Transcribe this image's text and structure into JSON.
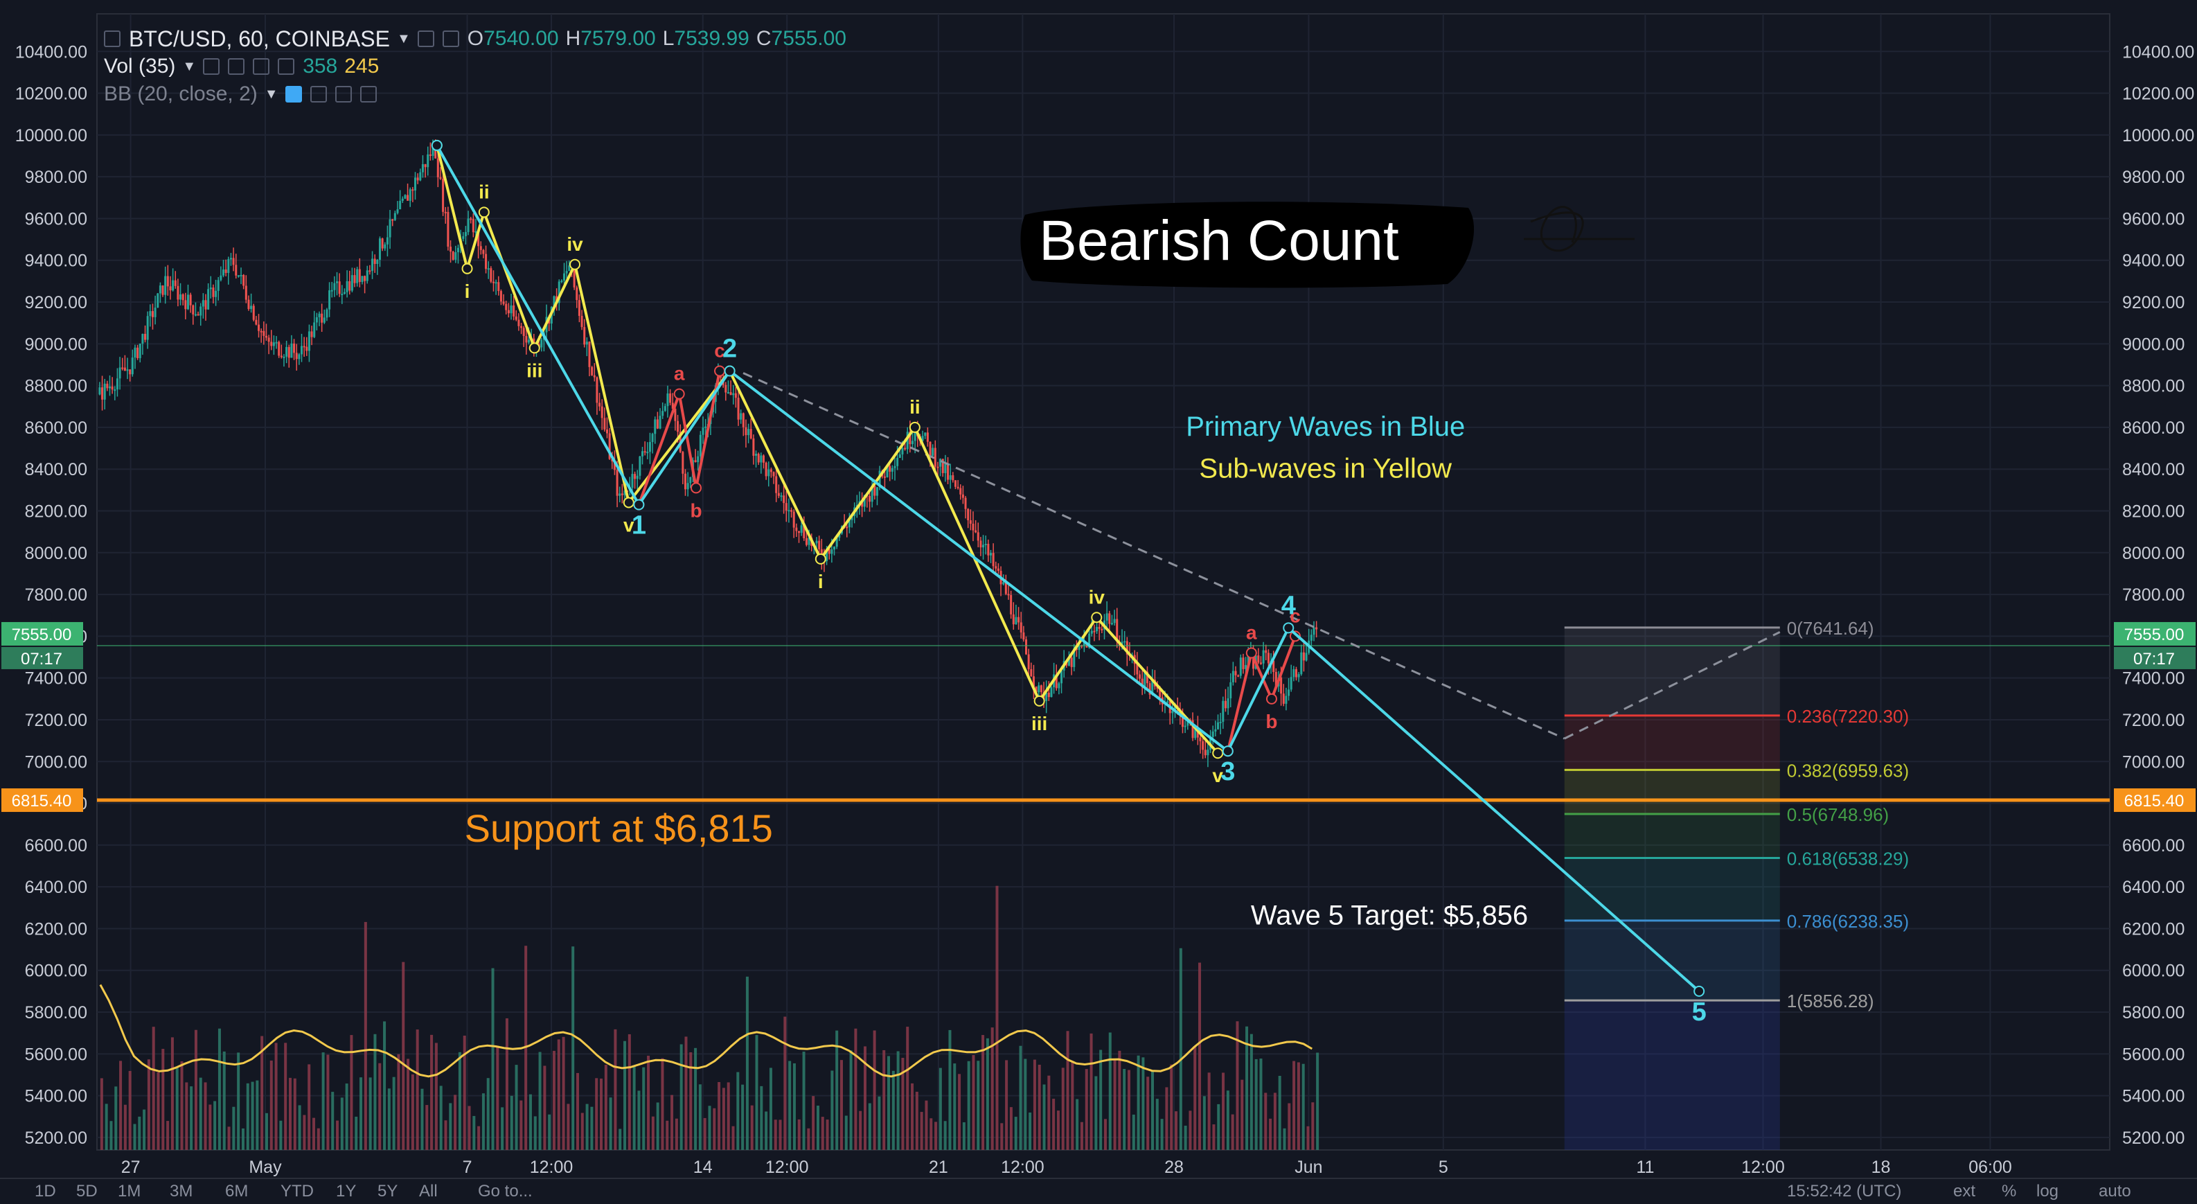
{
  "header": {
    "symbol": "BTC/USD, 60, COINBASE",
    "o_label": "O",
    "o_value": "7540.00",
    "h_label": "H",
    "h_value": "7579.00",
    "l_label": "L",
    "l_value": "7539.99",
    "c_label": "C",
    "c_value": "7555.00"
  },
  "indicators": {
    "vol_label": "Vol (35)",
    "vol_value_1": "358",
    "vol_value_2": "245",
    "bb_label": "BB (20, close, 2)"
  },
  "bottom_bar": {
    "intervals": [
      "1D",
      "5D",
      "1M",
      "3M",
      "6M",
      "YTD",
      "1Y",
      "5Y",
      "All"
    ],
    "goto": "Go to...",
    "time": "15:52:42 (UTC)",
    "right": [
      "ext",
      "%",
      "log",
      "auto"
    ]
  },
  "colors": {
    "background": "#131722",
    "primary_wave": "#4dd8e8",
    "sub_wave": "#f2e94e",
    "corrective_wave": "#e84a4a",
    "support": "#f7931a",
    "price_tag": "#3cb371",
    "volume_ma": "#f2c94c"
  },
  "chart_data": {
    "type": "candlestick",
    "title": "Bearish Count",
    "y_ticks": [
      10400,
      10200,
      10000,
      9800,
      9600,
      9400,
      9200,
      9000,
      8800,
      8600,
      8400,
      8200,
      8000,
      7800,
      7600,
      7400,
      7200,
      7000,
      6800,
      6600,
      6400,
      6200,
      6000,
      5800,
      5600,
      5400,
      5200
    ],
    "y_tick_labels": [
      "10400.00",
      "10200.00",
      "10000.00",
      "9800.00",
      "9600.00",
      "9400.00",
      "9200.00",
      "9000.00",
      "8800.00",
      "8600.00",
      "8400.00",
      "8200.00",
      "8000.00",
      "7800.00",
      "7600.00",
      "7400.00",
      "7200.00",
      "7000.00",
      "6800.00",
      "6600.00",
      "6400.00",
      "6200.00",
      "6000.00",
      "5800.00",
      "5600.00",
      "5400.00",
      "5200.00"
    ],
    "ylim": [
      5140,
      10580
    ],
    "x_ticks": [
      {
        "label": "27",
        "x": 0
      },
      {
        "label": "May",
        "x": 4
      },
      {
        "label": "7",
        "x": 10
      },
      {
        "label": "12:00",
        "x": 12.5
      },
      {
        "label": "14",
        "x": 17
      },
      {
        "label": "12:00",
        "x": 19.5
      },
      {
        "label": "21",
        "x": 24
      },
      {
        "label": "12:00",
        "x": 26.5
      },
      {
        "label": "28",
        "x": 31
      },
      {
        "label": "Jun",
        "x": 35
      },
      {
        "label": "5",
        "x": 39
      },
      {
        "label": "11",
        "x": 45
      },
      {
        "label": "12:00",
        "x": 48.5
      },
      {
        "label": "18",
        "x": 52
      },
      {
        "label": "06:00",
        "x": 55.25
      }
    ],
    "xlim": [
      -1,
      58.8
    ],
    "current_price": {
      "label": "7555.00",
      "value": 7555,
      "countdown": "07:17"
    },
    "support": {
      "value": 6815,
      "tag": "6815.40",
      "text": "Support at $6,815"
    },
    "price_path": [
      [
        -1,
        8750
      ],
      [
        0,
        8900
      ],
      [
        1,
        9300
      ],
      [
        2,
        9150
      ],
      [
        3,
        9400
      ],
      [
        4,
        9000
      ],
      [
        5,
        8950
      ],
      [
        6,
        9250
      ],
      [
        7,
        9350
      ],
      [
        8,
        9650
      ],
      [
        9,
        9950
      ],
      [
        9.5,
        9400
      ],
      [
        10,
        9600
      ],
      [
        11,
        9200
      ],
      [
        12,
        8980
      ],
      [
        13,
        9380
      ],
      [
        14.5,
        8250
      ],
      [
        15,
        8400
      ],
      [
        16,
        8760
      ],
      [
        16.5,
        8300
      ],
      [
        17.5,
        8860
      ],
      [
        18.5,
        8500
      ],
      [
        19.5,
        8200
      ],
      [
        20.5,
        7980
      ],
      [
        22,
        8300
      ],
      [
        23.3,
        8600
      ],
      [
        24.5,
        8300
      ],
      [
        26,
        7800
      ],
      [
        27,
        7300
      ],
      [
        28,
        7500
      ],
      [
        29,
        7700
      ],
      [
        30,
        7400
      ],
      [
        31,
        7250
      ],
      [
        32,
        7050
      ],
      [
        32.8,
        7450
      ],
      [
        33.8,
        7500
      ],
      [
        34.2,
        7300
      ],
      [
        35.2,
        7640
      ]
    ],
    "primary_wave": {
      "name": "Primary Waves in Blue",
      "points": [
        {
          "label": "",
          "x": 9.1,
          "y": 9950
        },
        {
          "label": "1",
          "x": 15.1,
          "y": 8230
        },
        {
          "label": "2",
          "x": 17.8,
          "y": 8870
        },
        {
          "label": "3",
          "x": 32.6,
          "y": 7050
        },
        {
          "label": "4",
          "x": 34.4,
          "y": 7640
        },
        {
          "label": "5",
          "x": 46.6,
          "y": 5900
        }
      ]
    },
    "sub_waves": {
      "name": "Sub-waves in Yellow",
      "points": [
        {
          "label": "",
          "x": 9.1,
          "y": 9950
        },
        {
          "label": "i",
          "x": 10.0,
          "y": 9360
        },
        {
          "label": "ii",
          "x": 10.5,
          "y": 9630
        },
        {
          "label": "iii",
          "x": 12.0,
          "y": 8980
        },
        {
          "label": "iv",
          "x": 13.2,
          "y": 9380
        },
        {
          "label": "v",
          "x": 14.8,
          "y": 8240
        },
        {
          "label": "",
          "x": 17.8,
          "y": 8870
        },
        {
          "label": "i",
          "x": 20.5,
          "y": 7970
        },
        {
          "label": "ii",
          "x": 23.3,
          "y": 8600
        },
        {
          "label": "iii",
          "x": 27.0,
          "y": 7290
        },
        {
          "label": "iv",
          "x": 28.7,
          "y": 7690
        },
        {
          "label": "v",
          "x": 32.3,
          "y": 7040
        }
      ]
    },
    "corrective_waves": [
      {
        "points": [
          {
            "label": "",
            "x": 15.1,
            "y": 8230
          },
          {
            "label": "a",
            "x": 16.3,
            "y": 8760
          },
          {
            "label": "b",
            "x": 16.8,
            "y": 8310
          },
          {
            "label": "c",
            "x": 17.5,
            "y": 8870
          }
        ]
      },
      {
        "points": [
          {
            "label": "",
            "x": 32.6,
            "y": 7050
          },
          {
            "label": "a",
            "x": 33.3,
            "y": 7520
          },
          {
            "label": "b",
            "x": 33.9,
            "y": 7300
          },
          {
            "label": "c",
            "x": 34.6,
            "y": 7600
          }
        ]
      }
    ],
    "trendline": {
      "x1": 18.2,
      "y1": 8860,
      "x2": 42.6,
      "y2": 7110,
      "ext_x": 49.0,
      "ext_y": 7620
    },
    "fibonacci": {
      "x_start": 42.6,
      "x_end": 49.0,
      "levels": [
        {
          "label": "0(7641.64)",
          "value": 7641.64,
          "color": "#8d8d96"
        },
        {
          "label": "0.236(7220.30)",
          "value": 7220.3,
          "color": "#e53935"
        },
        {
          "label": "0.382(6959.63)",
          "value": 6959.63,
          "color": "#c0ca33"
        },
        {
          "label": "0.5(6748.96)",
          "value": 6748.96,
          "color": "#43a047"
        },
        {
          "label": "0.618(6538.29)",
          "value": 6538.29,
          "color": "#26a69a"
        },
        {
          "label": "0.786(6238.35)",
          "value": 6238.35,
          "color": "#3c8fd1"
        },
        {
          "label": "1(5856.28)",
          "value": 5856.28,
          "color": "#9e9e9e"
        }
      ]
    },
    "annotations": [
      {
        "text": "Primary Waves in Blue",
        "x": 35.5,
        "y": 8560,
        "color": "#4dd8e8"
      },
      {
        "text": "Sub-waves in Yellow",
        "x": 35.5,
        "y": 8360,
        "color": "#f2e94e"
      },
      {
        "text": "Wave 5 Target: $5,856",
        "x": 37.4,
        "y": 6220,
        "color": "#ffffff"
      }
    ]
  }
}
